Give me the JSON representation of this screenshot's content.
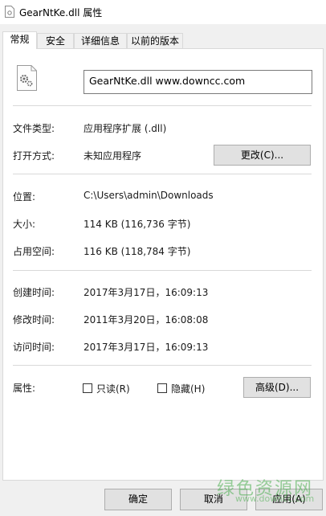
{
  "window": {
    "title": "GearNtKe.dll 属性"
  },
  "tabs": [
    {
      "label": "常规",
      "active": true
    },
    {
      "label": "安全",
      "active": false
    },
    {
      "label": "详细信息",
      "active": false
    },
    {
      "label": "以前的版本",
      "active": false
    }
  ],
  "file": {
    "name": "GearNtKe.dll     www.downcc.com"
  },
  "info": {
    "type_label": "文件类型:",
    "type_value": "应用程序扩展 (.dll)",
    "open_label": "打开方式:",
    "open_value": "未知应用程序",
    "change_button": "更改(C)...",
    "location_label": "位置:",
    "location_value": "C:\\Users\\admin\\Downloads",
    "size_label": "大小:",
    "size_value": "114 KB (116,736 字节)",
    "disk_label": "占用空间:",
    "disk_value": "116 KB (118,784 字节)",
    "created_label": "创建时间:",
    "created_value": "2017年3月17日，16:09:13",
    "modified_label": "修改时间:",
    "modified_value": "2011年3月20日，16:08:08",
    "accessed_label": "访问时间:",
    "accessed_value": "2017年3月17日，16:09:13",
    "attr_label": "属性:",
    "readonly_label": "只读(R)",
    "hidden_label": "隐藏(H)",
    "advanced_button": "高级(D)..."
  },
  "footer": {
    "ok": "确定",
    "cancel": "取消",
    "apply": "应用(A)"
  },
  "watermark": {
    "text": "绿色资源网",
    "sub": "www.downcc.com"
  },
  "icons": {
    "title_icon": "dll-file-icon",
    "file_icon": "gear-file-icon"
  }
}
